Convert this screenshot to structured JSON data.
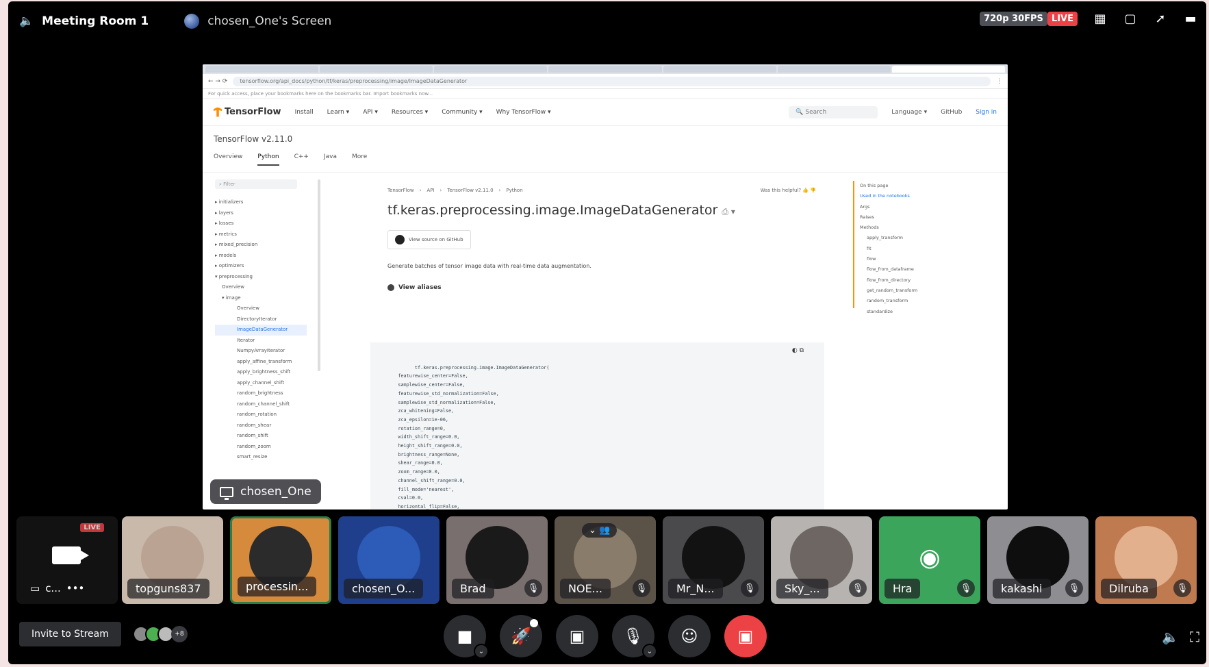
{
  "topbar": {
    "room": "Meeting Room 1",
    "screen_owner": "chosen_One's Screen",
    "quality": "720p 30FPS",
    "live": "LIVE"
  },
  "browser": {
    "url": "tensorflow.org/api_docs/python/tf/keras/preprocessing/image/ImageDataGenerator",
    "bookmarks_hint": "For quick access, place your bookmarks here on the bookmarks bar. Import bookmarks now..."
  },
  "tf": {
    "logo": "TensorFlow",
    "nav": [
      "Install",
      "Learn ▾",
      "API ▾",
      "Resources ▾",
      "Community ▾",
      "Why TensorFlow ▾"
    ],
    "search_placeholder": "Search",
    "language": "Language ▾",
    "github": "GitHub",
    "signin": "Sign in",
    "version": "TensorFlow v2.11.0",
    "subnav": [
      "Overview",
      "Python",
      "C++",
      "Java",
      "More"
    ],
    "filter_placeholder": "Filter",
    "sidebar": [
      {
        "label": "▸ initializers",
        "lvl": 0
      },
      {
        "label": "▸ layers",
        "lvl": 0
      },
      {
        "label": "▸ losses",
        "lvl": 0
      },
      {
        "label": "▸ metrics",
        "lvl": 0
      },
      {
        "label": "▸ mixed_precision",
        "lvl": 0
      },
      {
        "label": "▸ models",
        "lvl": 0
      },
      {
        "label": "▸ optimizers",
        "lvl": 0
      },
      {
        "label": "▾ preprocessing",
        "lvl": 0
      },
      {
        "label": "Overview",
        "lvl": 1
      },
      {
        "label": "▾ image",
        "lvl": 1
      },
      {
        "label": "Overview",
        "lvl": 2
      },
      {
        "label": "DirectoryIterator",
        "lvl": 2
      },
      {
        "label": "ImageDataGenerator",
        "lvl": 2,
        "sel": true
      },
      {
        "label": "Iterator",
        "lvl": 2
      },
      {
        "label": "NumpyArrayIterator",
        "lvl": 2
      },
      {
        "label": "apply_affine_transform",
        "lvl": 2
      },
      {
        "label": "apply_brightness_shift",
        "lvl": 2
      },
      {
        "label": "apply_channel_shift",
        "lvl": 2
      },
      {
        "label": "random_brightness",
        "lvl": 2
      },
      {
        "label": "random_channel_shift",
        "lvl": 2
      },
      {
        "label": "random_rotation",
        "lvl": 2
      },
      {
        "label": "random_shear",
        "lvl": 2
      },
      {
        "label": "random_shift",
        "lvl": 2
      },
      {
        "label": "random_zoom",
        "lvl": 2
      },
      {
        "label": "smart_resize",
        "lvl": 2
      }
    ],
    "breadcrumbs": [
      "TensorFlow",
      "›",
      "API",
      "›",
      "TensorFlow v2.11.0",
      "›",
      "Python"
    ],
    "helpful": "Was this helpful?",
    "title": "tf.keras.preprocessing.image.ImageDataGenerator",
    "github_btn": "View source on GitHub",
    "description": "Generate batches of tensor image data with real-time data augmentation.",
    "aliases": "View aliases",
    "code": "tf.keras.preprocessing.image.ImageDataGenerator(\n    featurewise_center=False,\n    samplewise_center=False,\n    featurewise_std_normalization=False,\n    samplewise_std_normalization=False,\n    zca_whitening=False,\n    zca_epsilon=1e-06,\n    rotation_range=0,\n    width_shift_range=0.0,\n    height_shift_range=0.0,\n    brightness_range=None,\n    shear_range=0.0,\n    zoom_range=0.0,\n    channel_shift_range=0.0,\n    fill_mode='nearest',\n    cval=0.0,\n    horizontal_flip=False,\n    vertical_flip=False,",
    "toc": [
      {
        "label": "On this page",
        "sub": false
      },
      {
        "label": "Used in the notebooks",
        "sub": false,
        "hl": true
      },
      {
        "label": "Args",
        "sub": false
      },
      {
        "label": "Raises",
        "sub": false
      },
      {
        "label": "Methods",
        "sub": false
      },
      {
        "label": "apply_transform",
        "sub": true
      },
      {
        "label": "fit",
        "sub": true
      },
      {
        "label": "flow",
        "sub": true
      },
      {
        "label": "flow_from_dataframe",
        "sub": true
      },
      {
        "label": "flow_from_directory",
        "sub": true
      },
      {
        "label": "get_random_transform",
        "sub": true
      },
      {
        "label": "random_transform",
        "sub": true
      },
      {
        "label": "standardize",
        "sub": true
      }
    ]
  },
  "presenter_tag": "chosen_One",
  "tiles": [
    {
      "name": "c...",
      "dots": "•••",
      "live": "LIVE"
    },
    {
      "name": "topguns837",
      "bg": "#c9b9aa",
      "av": "#bba393"
    },
    {
      "name": "processin...",
      "bg": "#d68a3c",
      "av": "#2b2b2b",
      "border": "#2d7d46"
    },
    {
      "name": "chosen_O...",
      "bg": "#1f3f8c",
      "av": "#2c5bb8"
    },
    {
      "name": "Brad",
      "bg": "#7a6f6f",
      "av": "#1a1a1a"
    },
    {
      "name": "NOE...",
      "bg": "#5b5248",
      "av": "#8a7c6b"
    },
    {
      "name": "Mr_N...",
      "bg": "#4a4a4d",
      "av": "#121212"
    },
    {
      "name": "Sky_...",
      "bg": "#b6b3b0",
      "av": "#6d6662"
    },
    {
      "name": "Hra",
      "bg": "#3ba55c",
      "av": "#3ba55c"
    },
    {
      "name": "kakashi",
      "bg": "#8e8e92",
      "av": "#0e0e0e"
    },
    {
      "name": "Dilruba",
      "bg": "#c07a4f",
      "av": "#e2b08c"
    }
  ],
  "bottom": {
    "invite": "Invite to Stream",
    "viewer_count": "+8"
  }
}
